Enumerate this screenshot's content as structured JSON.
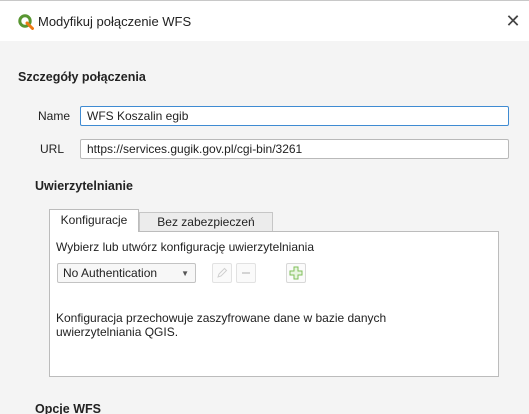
{
  "window": {
    "title": "Modyfikuj połączenie WFS",
    "close_symbol": "✕"
  },
  "details": {
    "section_title": "Szczegóły połączenia",
    "name_label": "Name",
    "name_value": "WFS Koszalin egib",
    "url_label": "URL",
    "url_value": "https://services.gugik.gov.pl/cgi-bin/3261"
  },
  "auth": {
    "section_title": "Uwierzytelnianie",
    "tabs": [
      {
        "label": "Konfiguracje",
        "active": true
      },
      {
        "label": "Bez zabezpieczeń",
        "active": false
      }
    ],
    "prompt": "Wybierz lub utwórz konfigurację uwierzytelniania",
    "selected_config": "No Authentication",
    "info": "Konfiguracja przechowuje zaszyfrowane dane w bazie danych uwierzytelniania QGIS."
  },
  "wfs_options": {
    "section_title": "Opcje WFS"
  },
  "icons": {
    "app": "qgis-logo-icon",
    "close": "close-icon",
    "edit": "pencil-edit-icon",
    "remove": "minus-remove-icon",
    "add": "plus-add-icon",
    "dropdown": "chevron-down-icon"
  },
  "colors": {
    "qgis_green": "#589632",
    "focus_border": "#3f8bd2",
    "add_icon_green": "#7fbf5a"
  }
}
